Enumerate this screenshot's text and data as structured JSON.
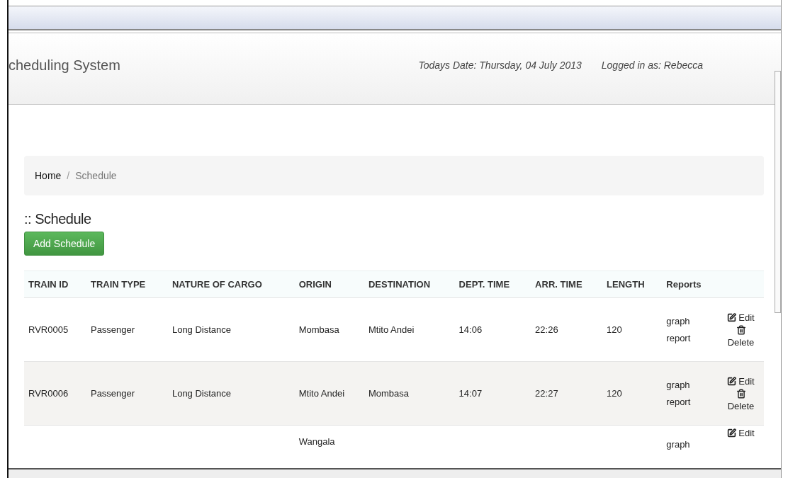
{
  "header": {
    "title": "cheduling System",
    "date": "Todays Date: Thursday, 04 July 2013",
    "user": "Logged in as: Rebecca"
  },
  "breadcrumb_separator": "/",
  "breadcrumb": [
    {
      "label": "Home",
      "selected": false
    },
    {
      "label": "Schedule",
      "selected": true
    }
  ],
  "heading": ":: Schedule",
  "add_button": "Add Schedule",
  "table": {
    "columns": [
      "TRAIN ID",
      "TRAIN TYPE",
      "NATURE OF CARGO",
      "ORIGIN",
      "DESTINATION",
      "DEPT. TIME",
      "ARR. TIME",
      "LENGTH",
      "Reports"
    ],
    "rows": [
      {
        "cells": {
          "train_id": "RVR0005",
          "train_type": "Passenger",
          "cargo": "Long Distance",
          "origin": "Mombasa",
          "destination": "Mtito Andei",
          "dept_time": "14:06",
          "arr_time": "22:26",
          "length": "120"
        },
        "reports": [
          "graph",
          "report"
        ],
        "actions": [
          "Edit",
          "Delete"
        ]
      },
      {
        "cells": {
          "train_id": "RVR0006",
          "train_type": "Passenger",
          "cargo": "Long Distance",
          "origin": "Mtito Andei",
          "destination": "Mombasa",
          "dept_time": "14:07",
          "arr_time": "22:27",
          "length": "120"
        },
        "reports": [
          "graph",
          "report"
        ],
        "actions": [
          "Edit",
          "Delete"
        ]
      },
      {
        "cells": {
          "origin": "Wangala"
        },
        "reports": [
          "graph"
        ],
        "actions": [
          "Edit"
        ]
      }
    ]
  }
}
